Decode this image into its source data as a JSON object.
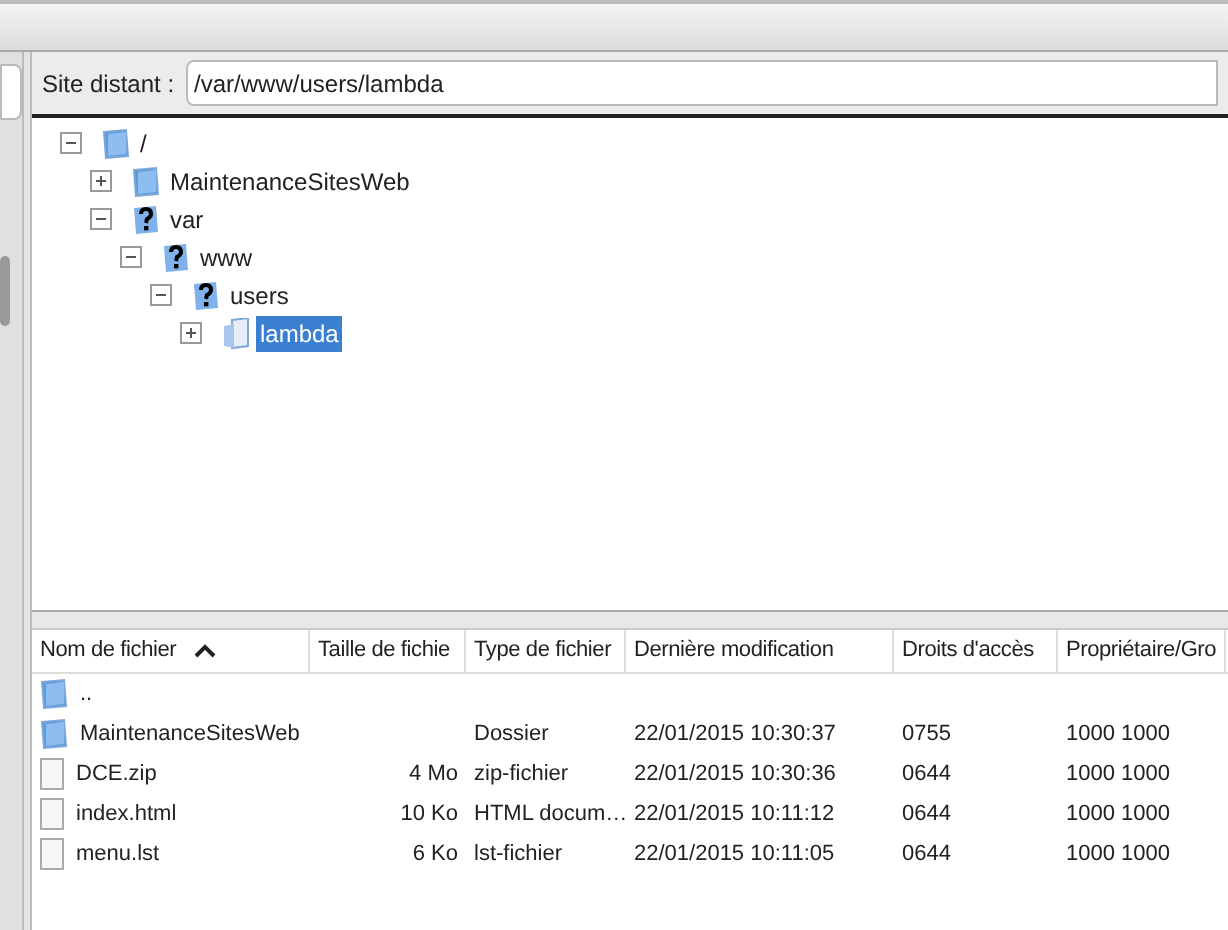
{
  "remote_site": {
    "label": "Site distant :",
    "value": "/var/www/users/lambda"
  },
  "tree": [
    {
      "name": "/",
      "kind": "folder",
      "expanded": true,
      "selected": false,
      "children": [
        {
          "name": "MaintenanceSitesWeb",
          "kind": "folder",
          "expanded": false,
          "selected": false
        },
        {
          "name": "var",
          "kind": "unknown",
          "expanded": true,
          "selected": false,
          "children": [
            {
              "name": "www",
              "kind": "unknown",
              "expanded": true,
              "selected": false,
              "children": [
                {
                  "name": "users",
                  "kind": "unknown",
                  "expanded": true,
                  "selected": false,
                  "children": [
                    {
                      "name": "lambda",
                      "kind": "open",
                      "expanded": false,
                      "selected": true
                    }
                  ]
                }
              ]
            }
          ]
        }
      ]
    }
  ],
  "table": {
    "columns": [
      {
        "label": "Nom de fichier",
        "sorted": true
      },
      {
        "label": "Taille de fichie",
        "sorted": false
      },
      {
        "label": "Type de fichier",
        "sorted": false
      },
      {
        "label": "Dernière modification",
        "sorted": false
      },
      {
        "label": "Droits d'accès",
        "sorted": false
      },
      {
        "label": "Propriétaire/Gro",
        "sorted": false
      }
    ],
    "rows": [
      {
        "kind": "folder",
        "name": "..",
        "size": "",
        "type": "",
        "modified": "",
        "rights": "",
        "owner": ""
      },
      {
        "kind": "folder",
        "name": "MaintenanceSitesWeb",
        "size": "",
        "type": "Dossier",
        "modified": "22/01/2015 10:30:37",
        "rights": "0755",
        "owner": "1000 1000"
      },
      {
        "kind": "file",
        "name": "DCE.zip",
        "size": "4 Mo",
        "type": "zip-fichier",
        "modified": "22/01/2015 10:30:36",
        "rights": "0644",
        "owner": "1000 1000"
      },
      {
        "kind": "file",
        "name": "index.html",
        "size": "10 Ko",
        "type": "HTML docum…",
        "modified": "22/01/2015 10:11:12",
        "rights": "0644",
        "owner": "1000 1000"
      },
      {
        "kind": "file",
        "name": "menu.lst",
        "size": "6 Ko",
        "type": "lst-fichier",
        "modified": "22/01/2015 10:11:05",
        "rights": "0644",
        "owner": "1000 1000"
      }
    ]
  }
}
